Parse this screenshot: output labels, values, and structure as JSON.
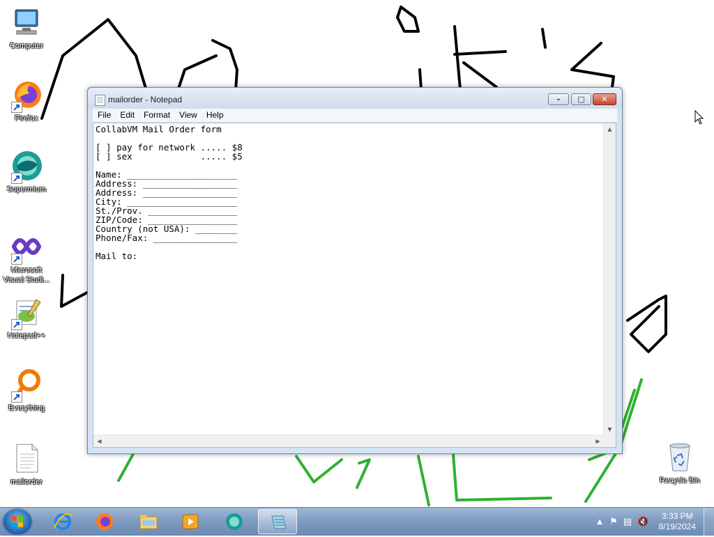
{
  "desktop": {
    "icons": [
      {
        "label": "Computer",
        "icon": "computer-icon"
      },
      {
        "label": "Firefox",
        "icon": "firefox-icon"
      },
      {
        "label": "Supermium",
        "icon": "supermium-icon"
      },
      {
        "label": "Microsoft Visual Studi...",
        "icon": "visual-studio-icon"
      },
      {
        "label": "Notepad++",
        "icon": "notepadpp-icon"
      },
      {
        "label": "Everything",
        "icon": "everything-icon"
      },
      {
        "label": "mailorder",
        "icon": "text-file-icon"
      },
      {
        "label": "Recycle Bin",
        "icon": "recycle-bin-icon"
      }
    ],
    "scribble_colors": {
      "black": "#000000",
      "green": "#2fb12f"
    }
  },
  "notepad": {
    "title": "mailorder - Notepad",
    "menu": [
      "File",
      "Edit",
      "Format",
      "View",
      "Help"
    ],
    "content": "CollabVM Mail Order form\n\n[ ] pay for network ..... $8\n[ ] sex             ..... $5\n\nName: _____________________\nAddress: __________________\nAddress: __________________\nCity: _____________________\nSt./Prov. _________________\nZIP/Code: _________________\nCountry (not USA): ________\nPhone/Fax: ________________\n\nMail to:",
    "controls": {
      "minimize": "minimize-icon",
      "maximize": "maximize-icon",
      "close": "close-icon"
    }
  },
  "taskbar": {
    "apps": [
      "Internet Explorer",
      "Firefox",
      "Windows Explorer",
      "Windows Media Player",
      "Supermium",
      "Notepad"
    ],
    "active_app": "Notepad",
    "clock": {
      "time": "3:33 PM",
      "date": "8/19/2024"
    },
    "tray_icons": [
      "show-hidden-icons-arrow",
      "action-center-flag-icon",
      "network-icon",
      "volume-muted-icon"
    ]
  }
}
